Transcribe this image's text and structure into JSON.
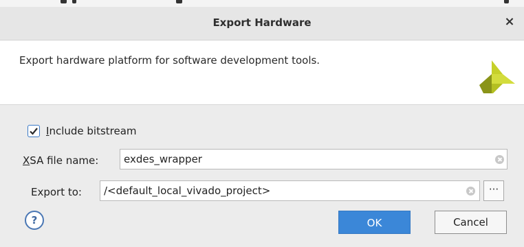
{
  "dialog": {
    "title": "Export Hardware",
    "close_glyph": "×",
    "description": "Export hardware platform for software development tools.",
    "logo_icon": "xilinx-logo"
  },
  "form": {
    "include_bitstream": {
      "checked": true,
      "label_mnemonic": "I",
      "label_rest": "nclude bitstream"
    },
    "xsa_file_name": {
      "label_mnemonic": "X",
      "label_rest": "SA file name:",
      "value": "exdes_wrapper"
    },
    "export_to": {
      "label": "Export to:",
      "value": "/<default_local_vivado_project>",
      "browse_label": "···"
    }
  },
  "buttons": {
    "help": "?",
    "ok": "OK",
    "cancel": "Cancel"
  },
  "colors": {
    "accent": "#3b87d8",
    "logo_dark": "#8a9418",
    "logo_light": "#c6d02a"
  }
}
